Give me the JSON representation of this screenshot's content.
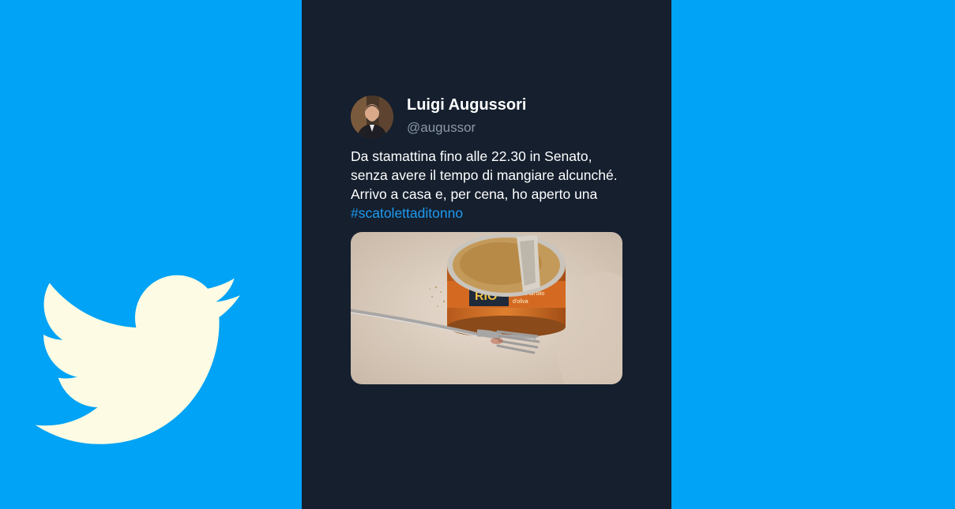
{
  "colors": {
    "brand_blue": "#00a3f5",
    "panel_dark": "#151f2e",
    "bird": "#fdfbe4",
    "hashtag": "#1d9bf0",
    "handle_gray": "#8b98a5"
  },
  "logo": {
    "icon": "twitter-bird-icon"
  },
  "tweet": {
    "author": {
      "display_name": "Luigi Augussori",
      "handle": "@augussor",
      "avatar_icon": "profile-photo"
    },
    "text_lines": [
      "Da stamattina fino alle 22.30 in Senato,",
      "senza avere il tempo di mangiare alcunché.",
      "Arrivo a casa e, per cena, ho aperto una"
    ],
    "hashtag": "#scatolettaditonno",
    "media": {
      "icon": "photo-tuna-can-with-fork",
      "can_label": "RIO MARE",
      "can_sublabel": "Tonno all'olio d'oliva"
    }
  }
}
